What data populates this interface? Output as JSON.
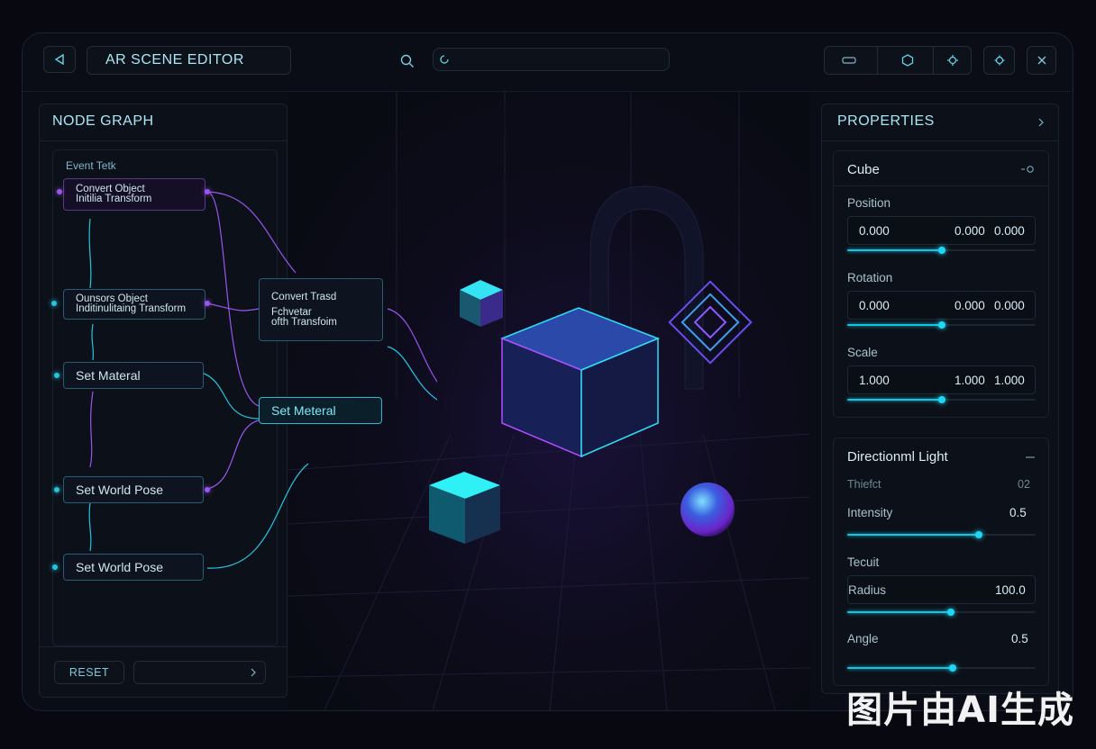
{
  "app": {
    "title": "AR SCENE EDITOR"
  },
  "search": {
    "placeholder": ""
  },
  "node_graph": {
    "title": "NODE GRAPH",
    "group_label": "Event Tetk",
    "nodes": {
      "convert1_line1": "Convert Object",
      "convert1_line2": "Initilia Transform",
      "convert2_line1": "Ounsors Object",
      "convert2_line2": "Inditinulitaing Transform",
      "convert3_line1": "Convert Trasd",
      "convert3_line2": "Fchvetar",
      "convert3_line3": "ofth Transfoim",
      "set_material_left": "Set Materal",
      "set_material_right": "Set Meteral",
      "set_world_pose_1": "Set World Pose",
      "set_world_pose_2": "Set World Pose"
    },
    "reset_label": "RESET"
  },
  "properties": {
    "title": "PROPERTIES",
    "object": {
      "name": "Cube",
      "position": {
        "label": "Position",
        "x": "0.000",
        "y": "0.000",
        "z": "0.000",
        "level": 0.5
      },
      "rotation": {
        "label": "Rotation",
        "x": "0.000",
        "y": "0.000",
        "z": "0.000",
        "level": 0.5
      },
      "scale": {
        "label": "Scale",
        "x": "1.000",
        "y": "1.000",
        "z": "1.000",
        "level": 0.5
      }
    },
    "light": {
      "name": "Directionml Light",
      "sub_label": "Thiefct",
      "sub_value": "02",
      "intensity": {
        "label": "Intensity",
        "value": "0.5",
        "level": 0.7
      },
      "section_label": "Tecuit",
      "radius": {
        "label": "Radius",
        "value": "100.0",
        "level": 0.55
      },
      "angle": {
        "label": "Angle",
        "value": "0.5",
        "level": 0.56
      }
    }
  },
  "watermark": "图片由AI生成",
  "colors": {
    "accent_cyan": "#16c3e3",
    "accent_purple": "#9a55f0",
    "background": "#0a0d16"
  },
  "icons": [
    "back-icon",
    "search-icon",
    "refresh-icon",
    "rectangle-icon",
    "hex-icon",
    "gear-icon",
    "settings-icon",
    "close-icon",
    "chevron-right-icon",
    "minus-icon"
  ]
}
